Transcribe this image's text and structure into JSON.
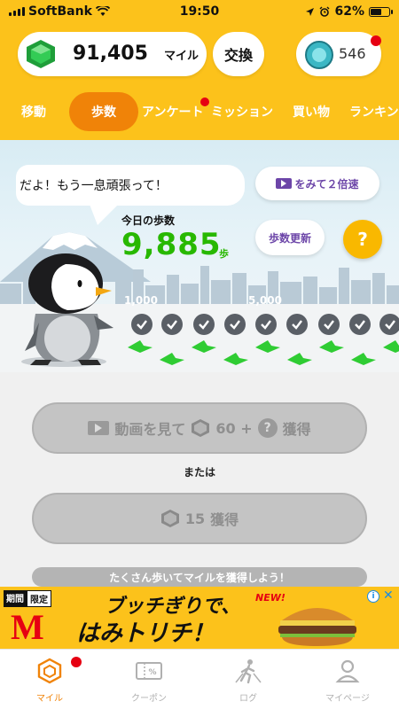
{
  "status_bar": {
    "carrier": "SoftBank",
    "time": "19:50",
    "battery": "62%",
    "battery_level": 0.62
  },
  "header": {
    "miles_value": "91,405",
    "miles_unit": "マイル",
    "exchange_label": "交換",
    "coins_value": "546"
  },
  "tabs": [
    {
      "label": "移動"
    },
    {
      "label": "歩数"
    },
    {
      "label": "アンケート"
    },
    {
      "label": "ミッション"
    },
    {
      "label": "買い物"
    },
    {
      "label": "ランキン"
    }
  ],
  "scene": {
    "bubble_text": "だよ！もう一息頑張って！",
    "ad_x2_label": "をみて２倍速",
    "steps_label": "今日の歩数",
    "steps_value": "9,885",
    "steps_unit": "歩",
    "update_label": "歩数更新",
    "help_label": "?",
    "milestones": [
      "1,000",
      "5,000"
    ]
  },
  "actions": {
    "video_label": "動画を見て",
    "video_amount": "60 +",
    "video_suffix": "獲得",
    "or_text": "または",
    "earn_amount": "15",
    "earn_suffix": "獲得",
    "hint_text": "たくさん歩いてマイルを獲得しよう！"
  },
  "ad": {
    "badge_dark": "期間",
    "badge_light": "限定",
    "logo": "M",
    "line1": "ブッチぎりで、",
    "line2": "はみトリチ！",
    "new_label": "NEW!",
    "info": "i",
    "close": "✕"
  },
  "bottom_nav": [
    {
      "label": "マイル",
      "icon": "hexagon-gem-icon"
    },
    {
      "label": "クーポン",
      "icon": "coupon-ticket-icon"
    },
    {
      "label": "ログ",
      "icon": "walking-log-icon"
    },
    {
      "label": "マイページ",
      "icon": "person-icon"
    }
  ],
  "colors": {
    "brand_yellow": "#fcc21b",
    "active_orange": "#f08308",
    "steps_green": "#28b800",
    "accent_purple": "#6c45a8",
    "notification_red": "#e60012"
  }
}
